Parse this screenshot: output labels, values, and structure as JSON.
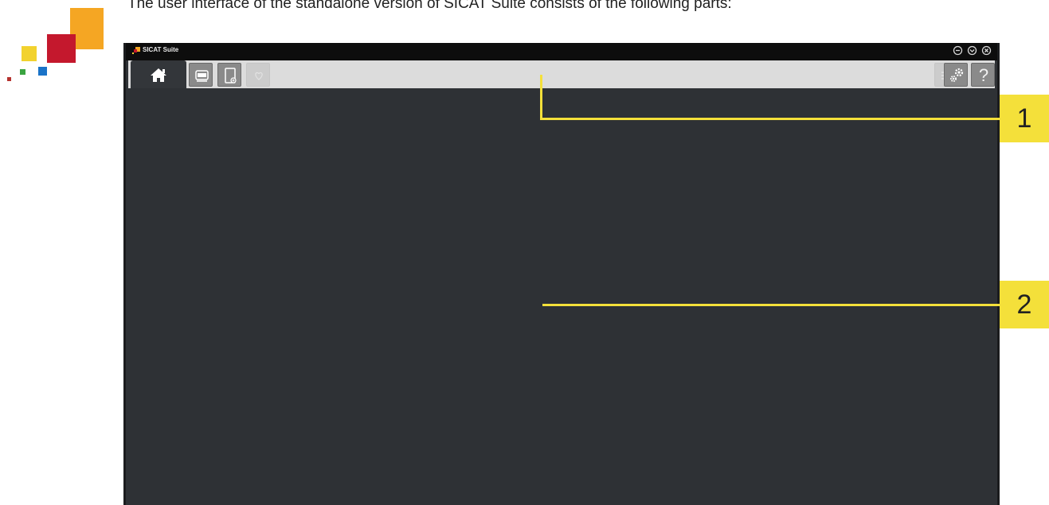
{
  "intro": {
    "text": "The user interface of the standalone version of SICAT Suite consists of the following parts:"
  },
  "logo": {
    "icon": "sicat-squares-logo",
    "colors": [
      "#f5a623",
      "#c4182d",
      "#f2d22e",
      "#1a73c8",
      "#3aa441",
      "#b5322e"
    ]
  },
  "window": {
    "title": "SICAT Suite",
    "controls": [
      {
        "icon": "minimize-icon"
      },
      {
        "icon": "restore-icon"
      },
      {
        "icon": "close-icon"
      }
    ]
  },
  "toolbar": {
    "left": [
      {
        "icon": "home-icon",
        "state": "active"
      },
      {
        "icon": "patient-records-icon",
        "state": "enabled"
      },
      {
        "icon": "new-document-icon",
        "state": "enabled"
      },
      {
        "icon": "heart-icon",
        "state": "disabled"
      }
    ],
    "right": [
      {
        "icon": "list-icon",
        "state": "disabled"
      },
      {
        "icon": "settings-icon",
        "state": "enabled"
      },
      {
        "icon": "help-icon",
        "label": "?",
        "state": "enabled"
      }
    ]
  },
  "callouts": [
    {
      "label": "1"
    },
    {
      "label": "2"
    }
  ],
  "colors": {
    "accent_yellow": "#f4e03a",
    "workspace": "#2e3135",
    "toolbar": "#dcdcdc",
    "titlebar": "#0d0d0d"
  }
}
